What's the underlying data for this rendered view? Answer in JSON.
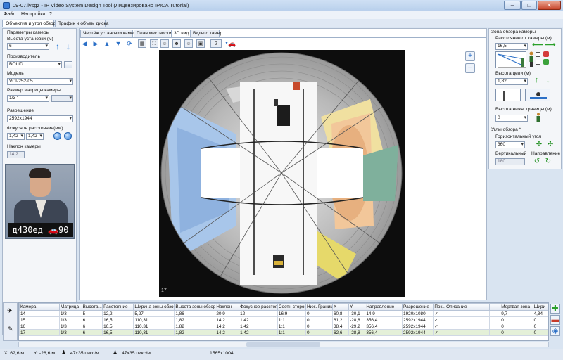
{
  "window": {
    "title": "09-07.ivsgz - IP Video System Design Tool (Лицензировано IPICA Tutorial)",
    "min": "–",
    "max": "□",
    "close": "✕"
  },
  "menu": [
    "Файл",
    "Настройки",
    "?"
  ],
  "main_tabs": [
    "Объектив и угол обзора",
    "Трафик и объем диска"
  ],
  "left": {
    "group_title": "Параметры камеры",
    "height_label": "Высота установки (м)",
    "height_value": "6",
    "manufacturer_label": "Производитель",
    "manufacturer_value": "BOLID",
    "browse_label": "...",
    "model_label": "Модель",
    "model_value": "VCI-252-05",
    "sensor_label": "Размер матрицы камеры",
    "sensor_value": "1/3 \"",
    "resolution_label": "Разрешение",
    "resolution_value": "2592x1944",
    "focal_label": "Фокусное расстояние(мм)",
    "focal_min": "1,42",
    "focal_max": "1,42",
    "tilt_label": "Наклон камеры",
    "tilt_value": "14,2",
    "face_text": "д430ед 🚗90"
  },
  "center_tabs": [
    "Чертёж установки камеры",
    "План местности",
    "3D вид",
    "Виды с камер"
  ],
  "view": {
    "camera_number": "17",
    "zoom_in": "+",
    "zoom_out": "–",
    "dropdown_value": "2"
  },
  "right": {
    "zone_title": "Зона обзора камеры",
    "distance_label": "Расстояние от камеры (м)",
    "distance_value": "16,5",
    "target_height_label": "Высота цели (м)",
    "target_height_value": "1,82",
    "lower_bound_label": "Высота нижн. границы (м)",
    "lower_bound_value": "0",
    "angles_title": "Углы обзора *",
    "horizontal_label": "Горизонтальный угол",
    "horizontal_value": "360",
    "vertical_label": "Вертикальный",
    "vertical_value": "180",
    "direction_label": "Направление"
  },
  "table": {
    "columns": [
      "Камера",
      "Матрица",
      "Высота ...",
      "Расстояние",
      "Ширина зоны обзора",
      "Высота зоны обзора",
      "Наклон",
      "Фокусное расстояние",
      "Соотн сторон",
      "Ниж. Граница",
      "X",
      "Y",
      "Направление",
      "Разрешение",
      "Пок...",
      "Описание",
      "",
      "Мертвая зона",
      "Шири"
    ],
    "rows": [
      [
        "14",
        "1/3",
        "5",
        "12,2",
        "5,27",
        "1,86",
        "20,9",
        "12",
        "16:9",
        "0",
        "60,8",
        "-30,1",
        "14,9",
        "1920x1080",
        "✓",
        "",
        "",
        "9,7",
        "4,34"
      ],
      [
        "15",
        "1/3",
        "6",
        "16,5",
        "110,31",
        "1,82",
        "14,2",
        "1,42",
        "1:1",
        "0",
        "61,2",
        "-28,8",
        "356,4",
        "2592x1944",
        "✓",
        "",
        "",
        "0",
        "0"
      ],
      [
        "16",
        "1/3",
        "6",
        "16,5",
        "110,31",
        "1,82",
        "14,2",
        "1,42",
        "1:1",
        "0",
        "38,4",
        "-29,2",
        "356,4",
        "2592x1944",
        "✓",
        "",
        "",
        "0",
        "0"
      ],
      [
        "17",
        "1/3",
        "6",
        "16,5",
        "110,31",
        "1,82",
        "14,2",
        "1,42",
        "1:1",
        "0",
        "62,6",
        "-28,8",
        "356,4",
        "2592x1944",
        "✓",
        "",
        "",
        "0",
        "0"
      ]
    ]
  },
  "status": {
    "x": "X: 62,6 м",
    "y": "Y: -28,6 м",
    "density1": "47x35 пикс/м",
    "density2": "47x35 пикс/м",
    "resolution": "1565x1004"
  }
}
